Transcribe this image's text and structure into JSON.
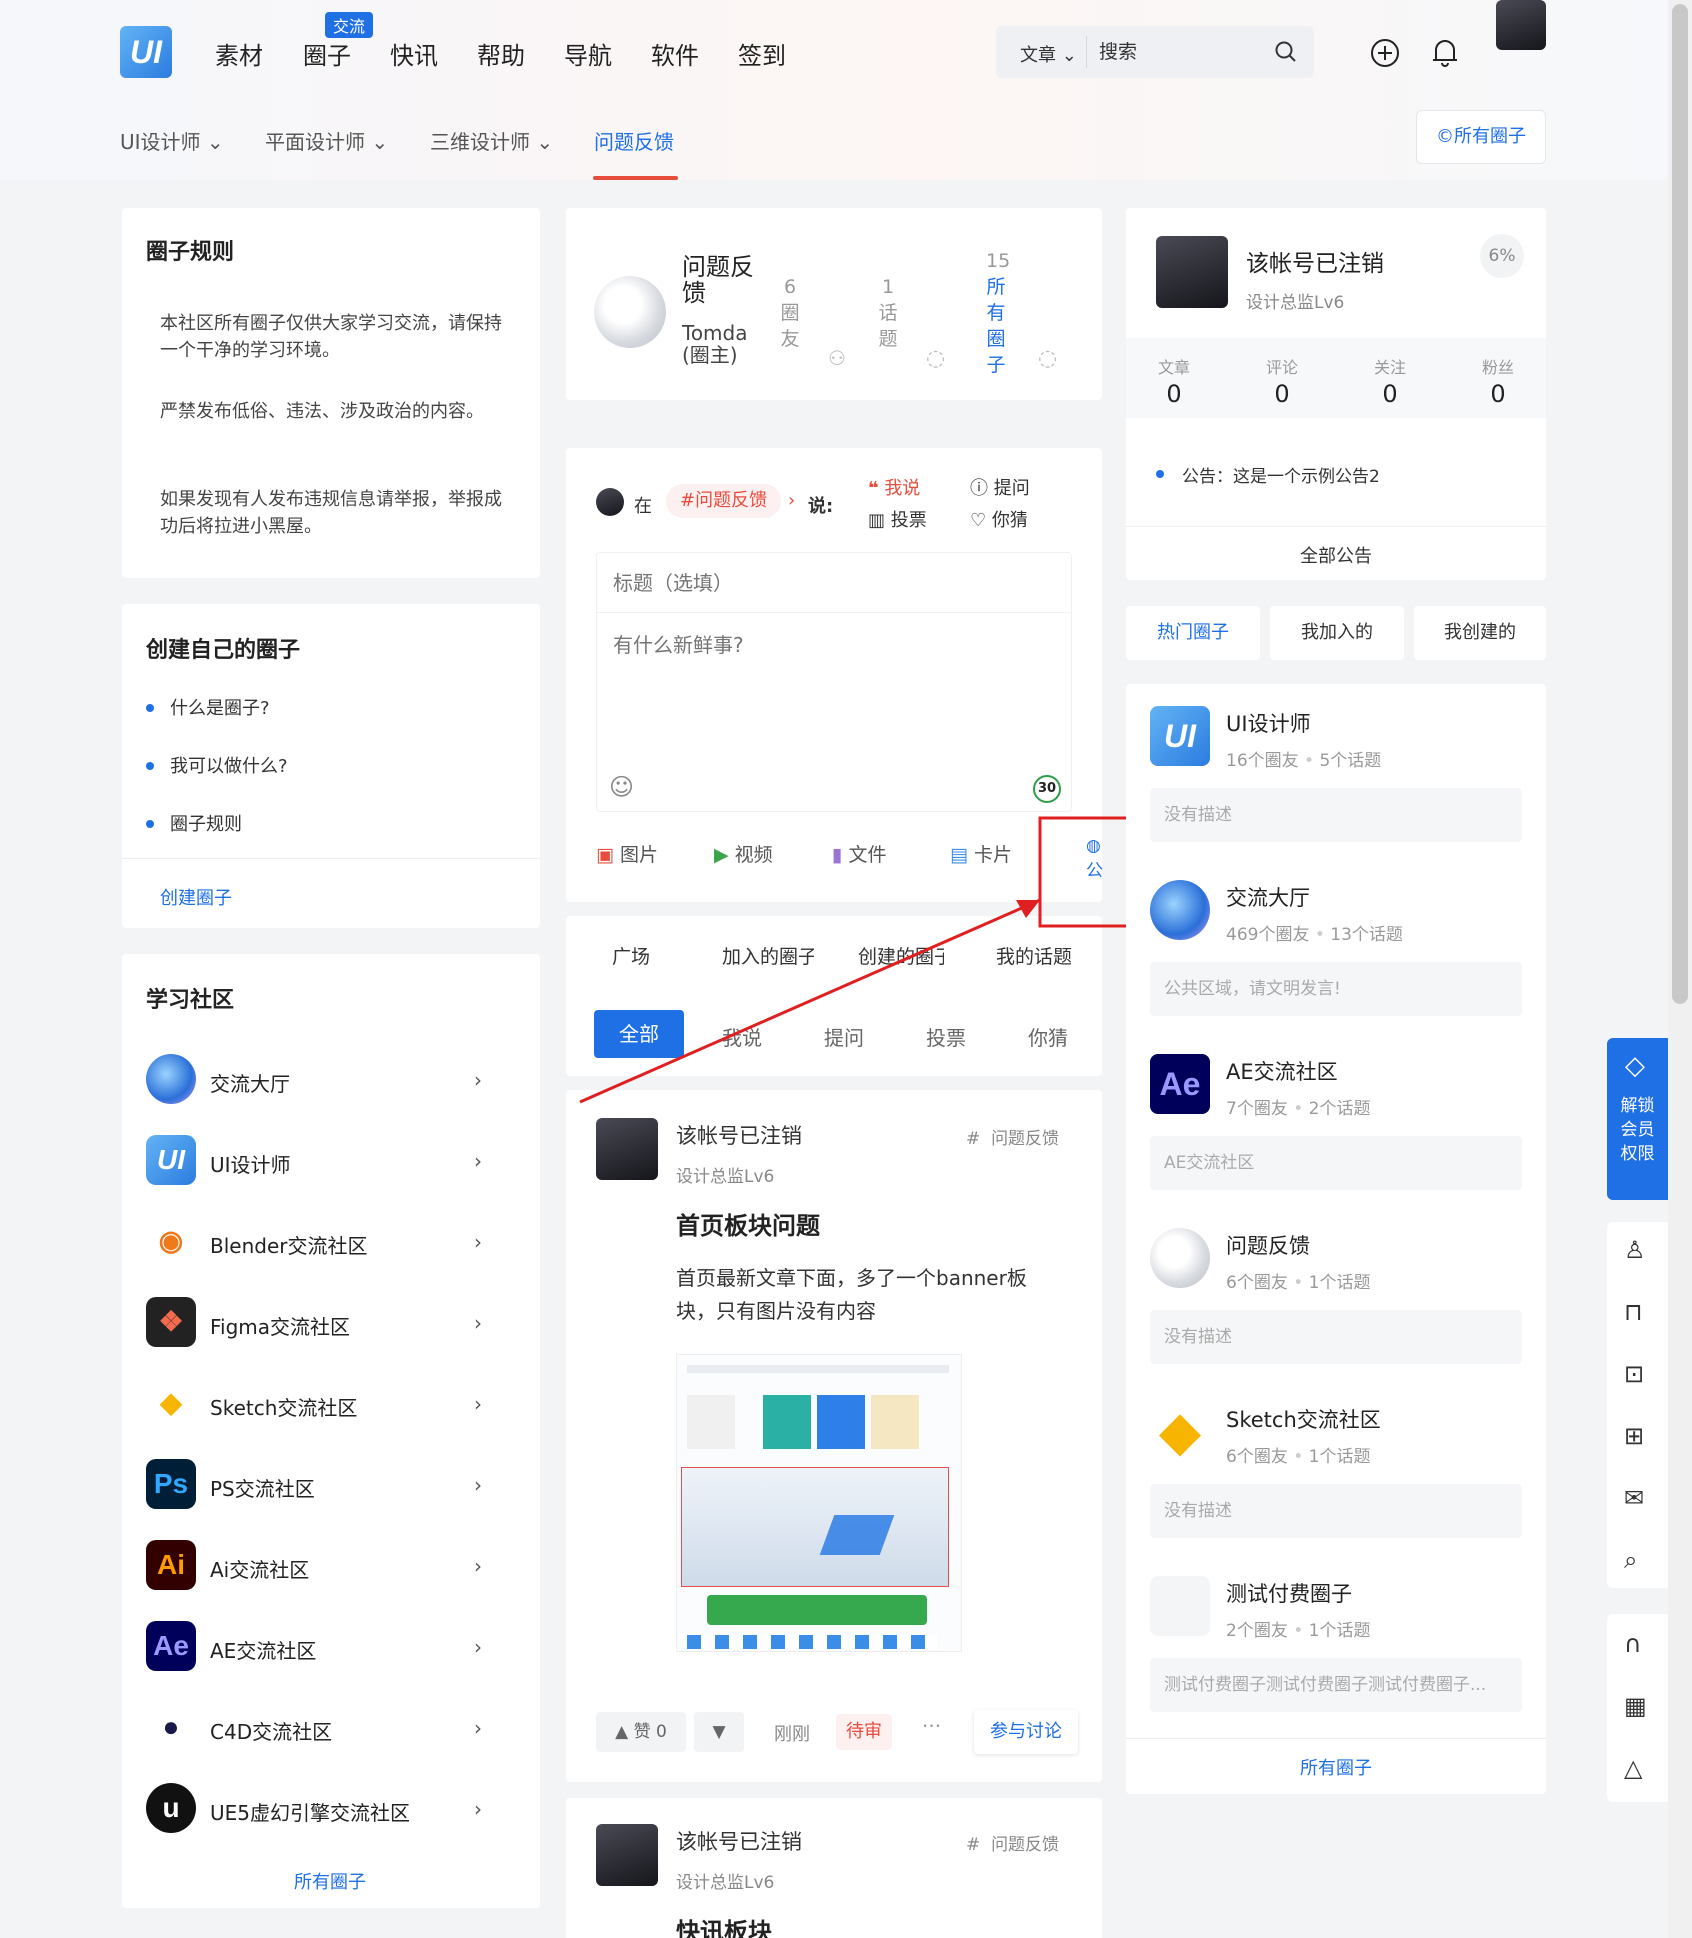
{
  "header": {
    "logo_text": "UI",
    "nav": [
      "素材",
      "圈子",
      "快讯",
      "帮助",
      "导航",
      "软件",
      "签到"
    ],
    "nav_badge": "交流",
    "search_select": "文章",
    "search_placeholder": "搜索"
  },
  "subnav": {
    "items": [
      "UI设计师",
      "平面设计师",
      "三维设计师",
      "问题反馈"
    ],
    "active": "问题反馈",
    "all_circles": "所有圈子"
  },
  "rules": {
    "title": "圈子规则",
    "paragraphs": [
      "本社区所有圈子仅供大家学习交流，请保持一个干净的学习环境。",
      "严禁发布低俗、违法、涉及政治的内容。",
      "如果发现有人发布违规信息请举报，举报成功后将拉进小黑屋。"
    ]
  },
  "create": {
    "title": "创建自己的圈子",
    "items": [
      "什么是圈子?",
      "我可以做什么?",
      "圈子规则"
    ],
    "link": "创建圈子"
  },
  "community": {
    "title": "学习社区",
    "items": [
      {
        "name": "交流大厅",
        "icon": "planet-icon"
      },
      {
        "name": "UI设计师",
        "icon": "ui-logo-icon"
      },
      {
        "name": "Blender交流社区",
        "icon": "blender-icon"
      },
      {
        "name": "Figma交流社区",
        "icon": "figma-icon"
      },
      {
        "name": "Sketch交流社区",
        "icon": "sketch-icon"
      },
      {
        "name": "PS交流社区",
        "icon": "ps-icon"
      },
      {
        "name": "Ai交流社区",
        "icon": "ai-icon"
      },
      {
        "name": "AE交流社区",
        "icon": "ae-icon"
      },
      {
        "name": "C4D交流社区",
        "icon": "c4d-icon"
      },
      {
        "name": "UE5虚幻引擎交流社区",
        "icon": "unreal-icon"
      }
    ],
    "link": "所有圈子"
  },
  "circle_head": {
    "name_line1": "问题反",
    "name_line2": "馈",
    "owner_line1": "Tomda",
    "owner_line2": "(圈主)",
    "stats": [
      {
        "num": "6",
        "chars": [
          "圈",
          "友"
        ]
      },
      {
        "num": "1",
        "chars": [
          "话",
          "题"
        ]
      },
      {
        "num": "15",
        "chars": [
          "所",
          "有",
          "圈",
          "子"
        ]
      }
    ]
  },
  "composer": {
    "in": "在",
    "tag": "#问题反馈",
    "say": "说:",
    "types": [
      "我说",
      "提问",
      "投票",
      "你猜"
    ],
    "title_placeholder": "标题（选填）",
    "body_placeholder": "有什么新鲜事?",
    "counter": "30",
    "tools": [
      "图片",
      "视频",
      "文件",
      "卡片"
    ],
    "public": "公"
  },
  "feed_tabs": [
    "广场",
    "加入的圈子",
    "创建的圈子",
    "我的话题"
  ],
  "filter_pills": [
    "全部",
    "我说",
    "提问",
    "投票",
    "你猜"
  ],
  "posts": [
    {
      "user": "该帐号已注销",
      "level": "设计总监Lv6",
      "tag": "问题反馈",
      "title": "首页板块问题",
      "body_line1": "首页最新文章下面，多了一个banner板",
      "body_line2": "块，只有图片没有内容",
      "like": "赞 0",
      "time": "刚刚",
      "status": "待审",
      "more": "···",
      "discuss": "参与讨论"
    },
    {
      "user": "该帐号已注销",
      "level": "设计总监Lv6",
      "tag": "问题反馈",
      "title": "快讯板块"
    }
  ],
  "profile": {
    "name": "该帐号已注销",
    "level": "设计总监Lv6",
    "percent": "6%",
    "stats": [
      {
        "label": "文章",
        "value": "0"
      },
      {
        "label": "评论",
        "value": "0"
      },
      {
        "label": "关注",
        "value": "0"
      },
      {
        "label": "粉丝",
        "value": "0"
      }
    ],
    "notice": "公告：这是一个示例公告2",
    "all_notices": "全部公告"
  },
  "right_tabs": [
    "热门圈子",
    "我加入的",
    "我创建的"
  ],
  "hot_circles": [
    {
      "name": "UI设计师",
      "members": "16个圈友",
      "topics": "5个话题",
      "desc": "没有描述"
    },
    {
      "name": "交流大厅",
      "members": "469个圈友",
      "topics": "13个话题",
      "desc": "公共区域，请文明发言!"
    },
    {
      "name": "AE交流社区",
      "members": "7个圈友",
      "topics": "2个话题",
      "desc": "AE交流社区"
    },
    {
      "name": "问题反馈",
      "members": "6个圈友",
      "topics": "1个话题",
      "desc": "没有描述"
    },
    {
      "name": "Sketch交流社区",
      "members": "6个圈友",
      "topics": "1个话题",
      "desc": "没有描述"
    },
    {
      "name": "测试付费圈子",
      "members": "2个圈友",
      "topics": "1个话题",
      "desc": "测试付费圈子测试付费圈子测试付费圈子..."
    }
  ],
  "right_link": "所有圈子",
  "side": {
    "vip_lines": [
      "解锁",
      "会员",
      "权限"
    ]
  },
  "colors": {
    "accent": "#1f6fe5",
    "highlight": "#e02020",
    "status": "#e74c3c"
  }
}
